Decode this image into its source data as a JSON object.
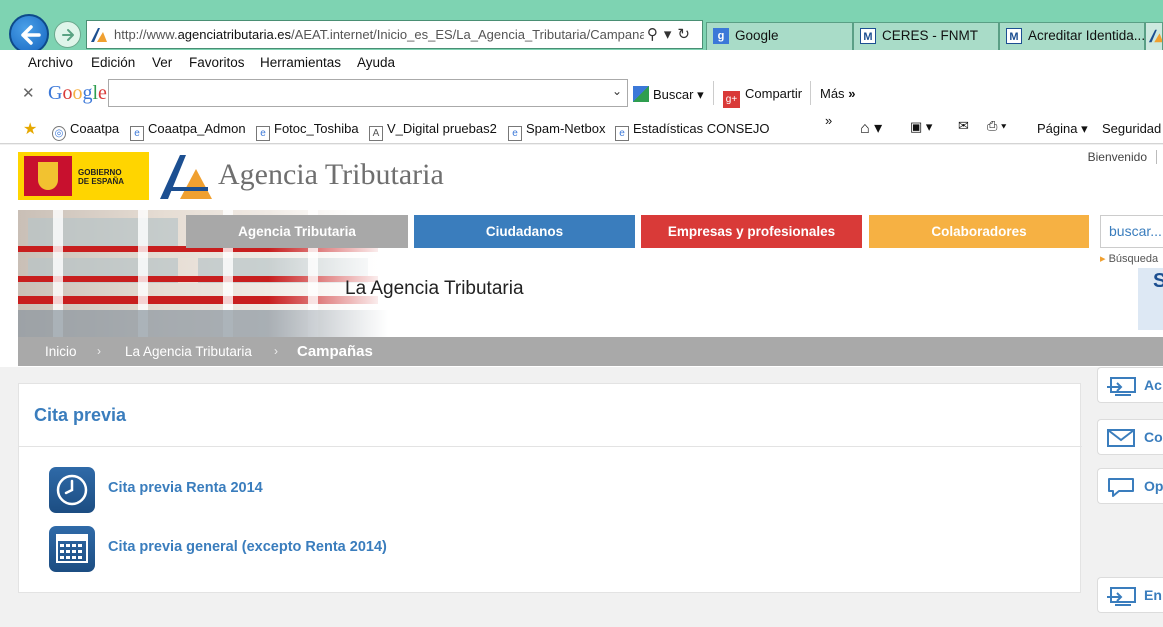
{
  "browser": {
    "address": {
      "url_prefix": "http://www.",
      "url_domain": "agenciatributaria.es",
      "url_path": "/AEAT.internet/Inicio_es_ES/La_Agencia_Tributaria/Campanas"
    },
    "tabs": [
      {
        "label": "Google"
      },
      {
        "label": "CERES - FNMT"
      },
      {
        "label": "Acreditar Identida..."
      }
    ],
    "menu": [
      "Archivo",
      "Edición",
      "Ver",
      "Favoritos",
      "Herramientas",
      "Ayuda"
    ],
    "google_bar": {
      "logo": "Google",
      "search_label": "Buscar",
      "share_label": "Compartir",
      "more_label": "Más"
    },
    "favorites": [
      "Coaatpa",
      "Coaatpa_Admon",
      "Fotoc_Toshiba",
      "V_Digital pruebas2",
      "Spam-Netbox",
      "Estadísticas CONSEJO"
    ],
    "command_bar": {
      "page_label": "Página",
      "security_label": "Seguridad"
    }
  },
  "site": {
    "welcome": "Bienvenido",
    "gov_logo_text": [
      "GOBIERNO",
      "DE ESPAÑA"
    ],
    "brand": "Agencia Tributaria",
    "nav": [
      {
        "label": "Agencia Tributaria",
        "color": "#a8a8a8"
      },
      {
        "label": "Ciudadanos",
        "color": "#3a7dbd"
      },
      {
        "label": "Empresas y profesionales",
        "color": "#d93a38"
      },
      {
        "label": "Colaboradores",
        "color": "#f6b143"
      }
    ],
    "search_placeholder": "buscar...",
    "search_hint": "Búsqueda",
    "side_card_letter": "S",
    "banner_title": "La Agencia Tributaria",
    "breadcrumb": {
      "items": [
        "Inicio",
        "La Agencia Tributaria"
      ],
      "current": "Campañas"
    },
    "section": {
      "title": "Cita previa",
      "links": [
        {
          "label": "Cita previa Renta 2014",
          "icon": "clock-icon"
        },
        {
          "label": "Cita previa general (excepto Renta 2014)",
          "icon": "calendar-icon"
        }
      ]
    },
    "side_buttons": [
      {
        "label": "Ac",
        "icon": "monitor-arrow-icon"
      },
      {
        "label": "Co",
        "icon": "envelope-icon"
      },
      {
        "label": "Opi",
        "icon": "speech-bubble-icon"
      },
      {
        "label": "En",
        "icon": "monitor-arrow-icon"
      }
    ]
  }
}
